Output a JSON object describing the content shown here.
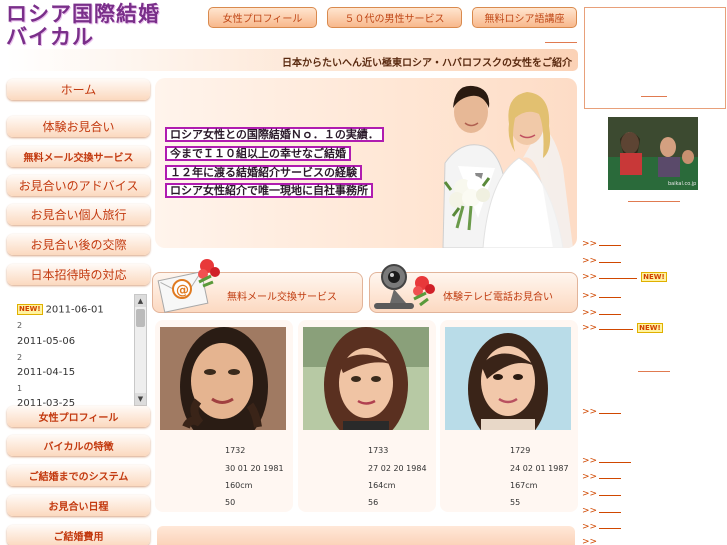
{
  "logo": {
    "line1": "ロシア国際結婚",
    "line2": "バイカル"
  },
  "top_nav": [
    "女性プロフィール",
    "５０代の男性サービス",
    "無料ロシア語講座"
  ],
  "tagline": "日本からたいへん近い極東ロシア・ハバロフスクの女性をご紹介",
  "sidebar": {
    "items": [
      "ホーム",
      "体験お見合い",
      "無料メール交換サービス",
      "お見合いのアドバイス",
      "お見合い個人旅行",
      "お見合い後の交際",
      "日本招待時の対応"
    ],
    "items2": [
      "女性プロフィール",
      "バイカルの特徴",
      "ご結婚までのシステム",
      "お見合い日程",
      "ご結婚費用"
    ]
  },
  "news": {
    "new_badge": "NEW!",
    "entries": [
      {
        "date": "2011-06-01",
        "num": ""
      },
      {
        "date": "2011-05-06",
        "num": "2"
      },
      {
        "date": "2011-04-15",
        "num": "2"
      },
      {
        "date": "2011-03-25",
        "num": "1"
      }
    ]
  },
  "hero": {
    "lines": [
      "ロシア女性との国際結婚Ｎｏ．１の実績．",
      "今までＩ１０組以上の幸せなご結婚",
      "１２年に渡る結婚紹介サービスの経験",
      "ロシア女性紹介で唯一現地に自社事務所"
    ]
  },
  "services": [
    {
      "label": "無料メール交換サービス",
      "icon": "email-envelope-icon"
    },
    {
      "label": "体験テレビ電話お見合い",
      "icon": "webcam-icon"
    }
  ],
  "profiles": [
    {
      "id": "1732",
      "birth": "30 01 20 1981",
      "height": "160cm",
      "weight": "50"
    },
    {
      "id": "1733",
      "birth": "27 02 20 1984",
      "height": "164cm",
      "weight": "56"
    },
    {
      "id": "1729",
      "birth": "24 02 01 1987",
      "height": "167cm",
      "weight": "55"
    }
  ],
  "right_links": {
    "prefix": ">>",
    "new_badge": "NEW!"
  },
  "right_thumb_caption": "baikal.co.jp"
}
